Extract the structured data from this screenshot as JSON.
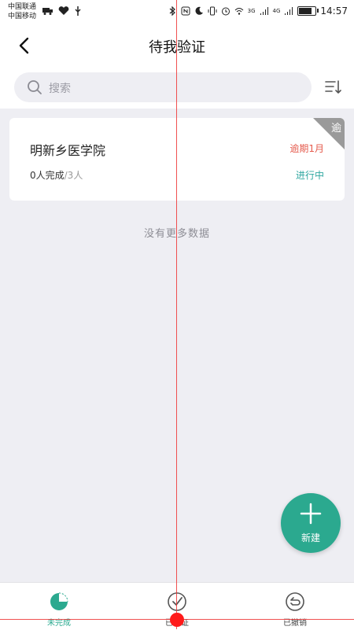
{
  "status_bar": {
    "carrier1": "中国联通",
    "carrier2": "中国移动",
    "network1": "3G",
    "network2": "4G",
    "time": "14:57"
  },
  "header": {
    "title": "待我验证",
    "back_icon": "chevron-left-icon"
  },
  "search": {
    "placeholder": "搜索",
    "icon": "search-icon",
    "sort_icon": "sort-list-icon"
  },
  "cards": [
    {
      "name": "明新乡医学院",
      "overdue": "逾期1月",
      "completed": "0人完成",
      "total": "/3人",
      "status": "进行中",
      "corner_label": "逾"
    }
  ],
  "empty_text": "没有更多数据",
  "fab": {
    "label": "新建",
    "icon": "plus-icon"
  },
  "tabs": [
    {
      "label": "未完成",
      "icon": "pie-progress-icon",
      "active": true
    },
    {
      "label": "已验证",
      "icon": "check-circle-icon",
      "active": false
    },
    {
      "label": "已撤销",
      "icon": "undo-circle-icon",
      "active": false
    }
  ],
  "colors": {
    "accent": "#2ba98f",
    "overdue": "#e55b4d",
    "status": "#2fa7a0",
    "background": "#eeeef3"
  }
}
